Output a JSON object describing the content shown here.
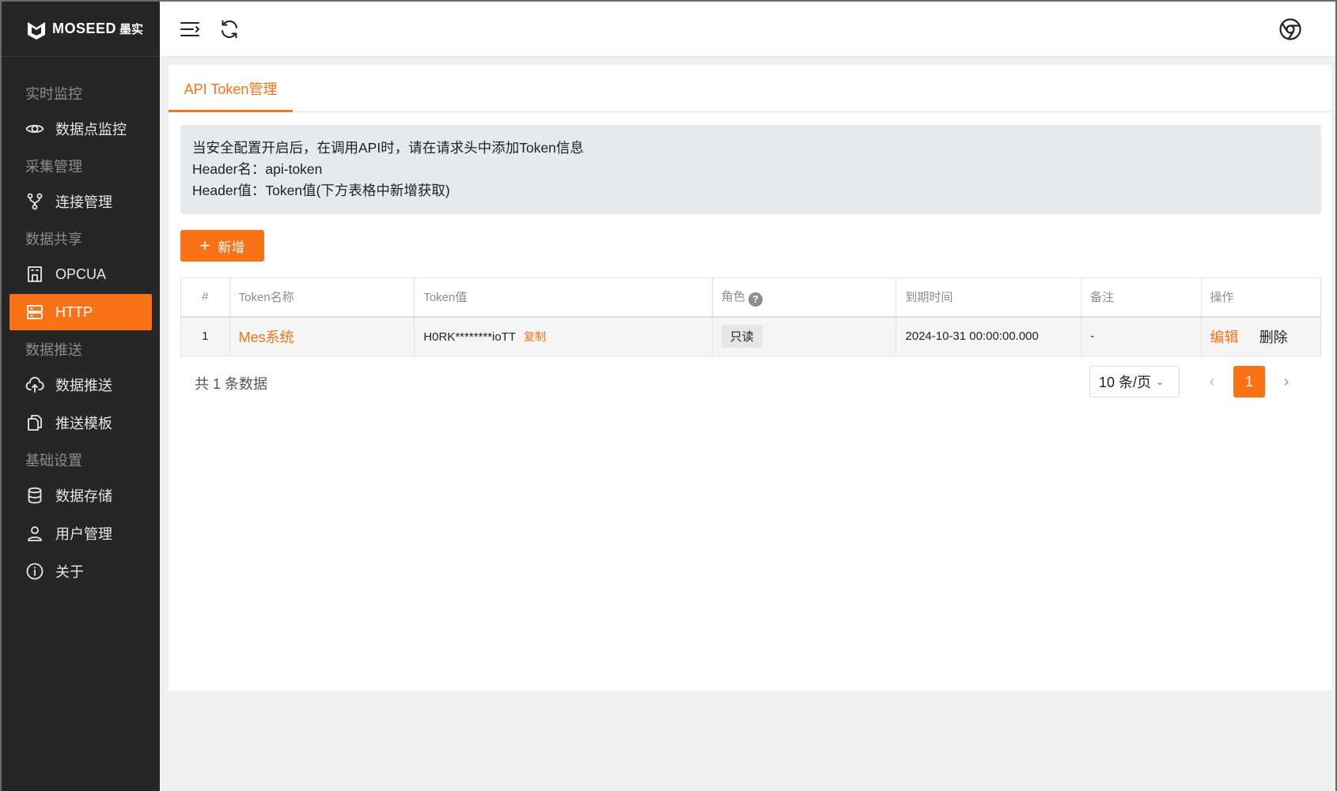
{
  "brand": {
    "name": "MOSEED",
    "cn": "墨实"
  },
  "sidebar": {
    "groups": [
      {
        "label": "实时监控",
        "items": [
          {
            "label": "数据点监控",
            "icon": "eye-icon"
          }
        ]
      },
      {
        "label": "采集管理",
        "items": [
          {
            "label": "连接管理",
            "icon": "branch-icon"
          }
        ]
      },
      {
        "label": "数据共享",
        "items": [
          {
            "label": "OPCUA",
            "icon": "building-icon"
          },
          {
            "label": "HTTP",
            "icon": "server-icon",
            "active": true
          }
        ]
      },
      {
        "label": "数据推送",
        "items": [
          {
            "label": "数据推送",
            "icon": "cloud-upload-icon"
          },
          {
            "label": "推送模板",
            "icon": "copy-icon"
          }
        ]
      },
      {
        "label": "基础设置",
        "items": [
          {
            "label": "数据存储",
            "icon": "database-icon"
          },
          {
            "label": "用户管理",
            "icon": "user-icon"
          },
          {
            "label": "关于",
            "icon": "info-icon"
          }
        ]
      }
    ]
  },
  "tabs": [
    {
      "label": "API Token管理",
      "active": true
    }
  ],
  "notice": {
    "line1": "当安全配置开启后，在调用API时，请在请求头中添加Token信息",
    "line2": "Header名：api-token",
    "line3": "Header值：Token值(下方表格中新增获取)"
  },
  "toolbar": {
    "add_label": "新增"
  },
  "table": {
    "headers": {
      "index": "#",
      "name": "Token名称",
      "value": "Token值",
      "role": "角色",
      "expire": "到期时间",
      "remark": "备注",
      "action": "操作"
    },
    "rows": [
      {
        "index": "1",
        "name": "Mes系统",
        "value": "H0RK********ioTT",
        "copy": "复制",
        "role": "只读",
        "expire": "2024-10-31 00:00:00.000",
        "remark": "-",
        "edit": "编辑",
        "delete": "删除"
      }
    ]
  },
  "pagination": {
    "total_text": "共 1 条数据",
    "page_size": "10 条/页",
    "current_page": "1"
  },
  "colors": {
    "accent": "#f97316",
    "sidebar_bg": "#262626"
  }
}
